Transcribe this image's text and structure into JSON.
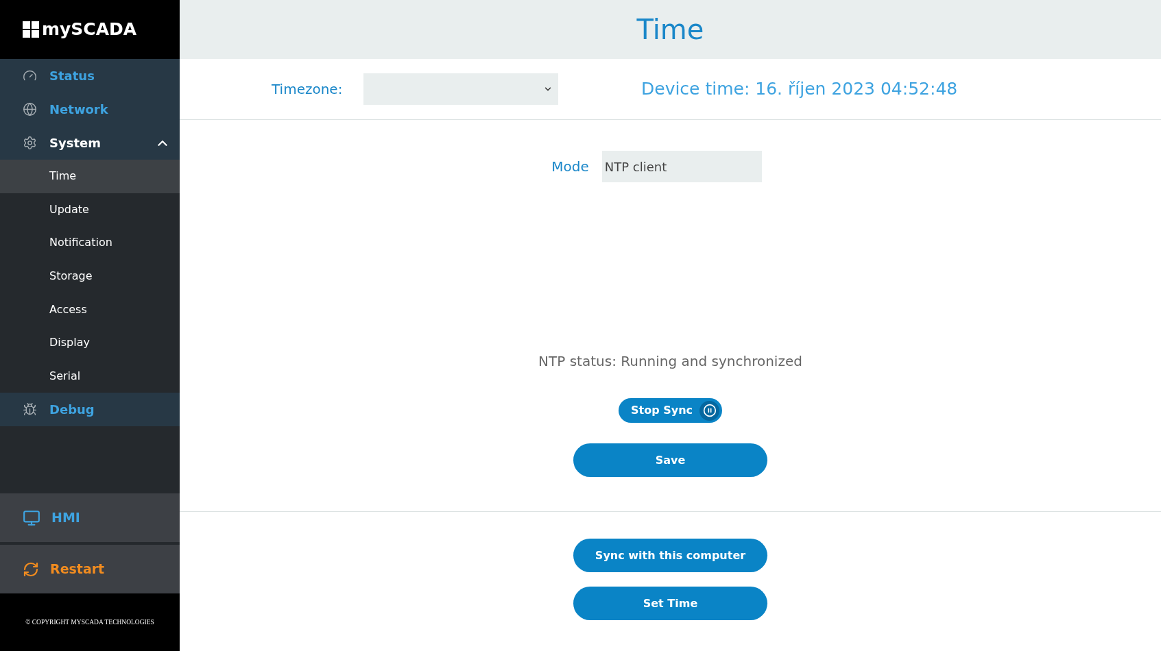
{
  "sidebar": {
    "logo": "mySCADA",
    "nav": [
      {
        "label": "Status",
        "expanded": false
      },
      {
        "label": "Network",
        "expanded": false
      },
      {
        "label": "System",
        "expanded": true,
        "children": [
          {
            "label": "Time",
            "selected": true
          },
          {
            "label": "Update",
            "selected": false
          },
          {
            "label": "Notification",
            "selected": false
          },
          {
            "label": "Storage",
            "selected": false
          },
          {
            "label": "Access",
            "selected": false
          },
          {
            "label": "Display",
            "selected": false
          },
          {
            "label": "Serial",
            "selected": false
          }
        ]
      },
      {
        "label": "Debug",
        "expanded": false
      }
    ],
    "hmi": {
      "label": "HMI"
    },
    "restart": {
      "label": "Restart"
    },
    "copyright": "© COPYRIGHT MYSCADA TECHNOLOGIES"
  },
  "page": {
    "title": "Time",
    "timezone": {
      "label": "Timezone:"
    },
    "device_time": "Device time: 16. říjen 2023 04:52:48",
    "mode": {
      "label": "Mode",
      "value": "NTP client"
    },
    "ntp_status": "NTP status: Running and synchronized",
    "stop_sync": "Stop Sync",
    "save": "Save",
    "sync_computer": "Sync with this computer",
    "set_time": "Set Time"
  }
}
